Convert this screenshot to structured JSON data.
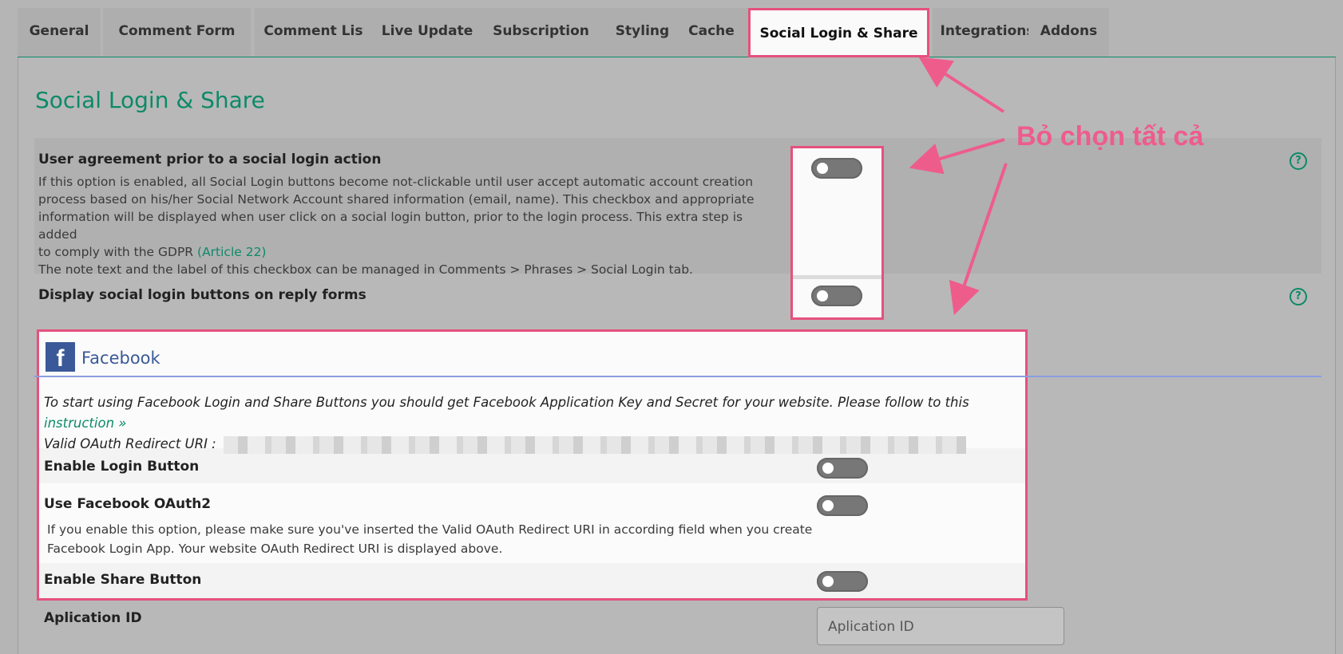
{
  "tabs": [
    {
      "label": "General",
      "active": false
    },
    {
      "label": "Comment Form",
      "active": false
    },
    {
      "label": "Comment List",
      "active": false
    },
    {
      "label": "Live Update",
      "active": false
    },
    {
      "label": "Subscription",
      "active": false
    },
    {
      "label": "Styling",
      "active": false
    },
    {
      "label": "Cache",
      "active": false
    },
    {
      "label": "Social Login & Share",
      "active": true
    },
    {
      "label": "Integrations",
      "active": false
    },
    {
      "label": "Addons",
      "active": false
    }
  ],
  "page": {
    "title": "Social Login & Share"
  },
  "options": {
    "user_agreement": {
      "title": "User agreement prior to a social login action",
      "desc_lines": [
        "If this option is enabled, all Social Login buttons become not-clickable until user accept automatic account creation",
        "process based on his/her Social Network Account shared information (email, name). This checkbox and appropriate",
        "information will be displayed when user click on a social login button, prior to the login process. This extra step is added",
        "to comply with the GDPR"
      ],
      "link": "(Article 22)",
      "note": "The note text and the label of this checkbox can be managed in Comments > Phrases > Social Login tab.",
      "enabled": false
    },
    "reply_forms": {
      "title": "Display social login buttons on reply forms",
      "enabled": false
    }
  },
  "facebook": {
    "title": "Facebook",
    "intro": "To start using Facebook Login and Share Buttons you should get Facebook Application Key and Secret for your website. Please follow to this",
    "link": "instruction »",
    "uri_label": "Valid OAuth Redirect URI :",
    "enable_login": {
      "label": "Enable Login Button",
      "enabled": false
    },
    "use_oauth2": {
      "label": "Use Facebook OAuth2",
      "desc_lines": [
        "If you enable this option, please make sure you've inserted the Valid OAuth Redirect URI in according field when you create",
        "Facebook Login App. Your website OAuth Redirect URI is displayed above."
      ],
      "enabled": false
    },
    "enable_share": {
      "label": "Enable Share Button",
      "enabled": false
    },
    "app_id": {
      "label": "Aplication ID",
      "placeholder": "Aplication ID"
    }
  },
  "annotation": {
    "text": "Bỏ chọn tất cả"
  },
  "colors": {
    "accent": "#0c8a67",
    "highlight": "#e5517e",
    "facebook": "#3b5998"
  }
}
